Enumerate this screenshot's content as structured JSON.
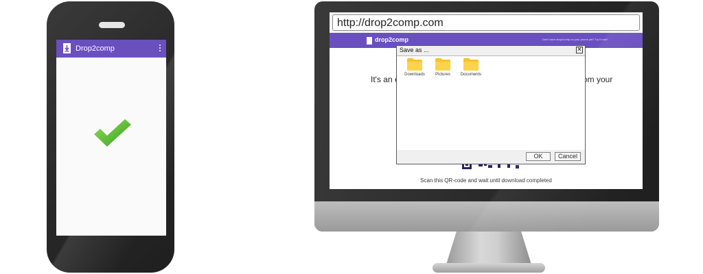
{
  "phone": {
    "app_title": "Drop2comp",
    "status_icon": "checkmark-icon",
    "colors": {
      "app_bar": "#6a4fbf",
      "check": "#5cc22a"
    }
  },
  "computer": {
    "browser": {
      "url": "http://drop2comp.com"
    },
    "site": {
      "name": "drop2comp",
      "promo": "Don't have drop2comp on your phone yet? Try it now!",
      "heading_left": "It's an e",
      "heading_right": "om your",
      "scan_text": "Scan this QR-code and wait until download completed",
      "colors": {
        "header": "#6a4fbf"
      }
    },
    "dialog": {
      "title": "Save as ...",
      "close_symbol": "✕",
      "folders": [
        {
          "label": "Downloads",
          "icon": "folder-icon"
        },
        {
          "label": "Pictures",
          "icon": "folder-icon"
        },
        {
          "label": "Documents",
          "icon": "folder-icon"
        }
      ],
      "ok_label": "OK",
      "cancel_label": "Cancel",
      "colors": {
        "folder": "#f7c325"
      }
    }
  }
}
